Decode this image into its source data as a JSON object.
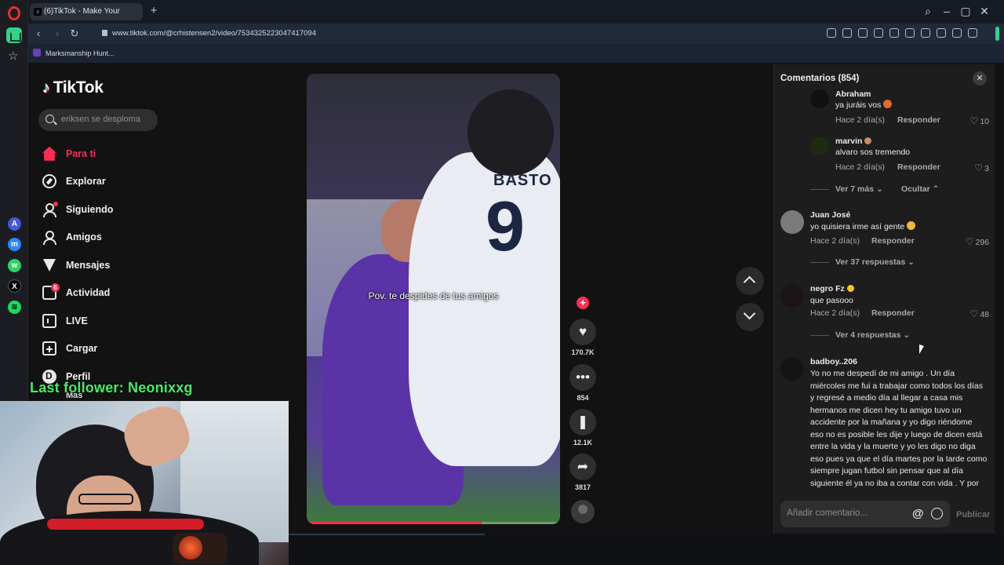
{
  "browser": {
    "tab_title": "(6)TikTok - Make Your",
    "url": "www.tiktok.com/@crhistensen2/video/7534325223047417094",
    "bookmark": "Marksmanship Hunt..."
  },
  "sidebar": {
    "logo": "TikTok",
    "search_placeholder": "eriksen se desploma",
    "items": [
      {
        "label": "Para ti",
        "icon": "home-icon"
      },
      {
        "label": "Explorar",
        "icon": "compass-icon"
      },
      {
        "label": "Siguiendo",
        "icon": "following-icon"
      },
      {
        "label": "Amigos",
        "icon": "friends-icon"
      },
      {
        "label": "Mensajes",
        "icon": "messages-icon"
      },
      {
        "label": "Actividad",
        "icon": "activity-icon",
        "badge": "6"
      },
      {
        "label": "LIVE",
        "icon": "live-icon"
      },
      {
        "label": "Cargar",
        "icon": "upload-icon"
      },
      {
        "label": "Perfil",
        "icon": "profile-icon"
      }
    ],
    "more": "Más"
  },
  "overlay": {
    "last_follower": "Last follower: Neonixxg"
  },
  "video": {
    "caption": "Pov. te despides de tus amigos",
    "jersey_name": "BASTO",
    "jersey_number": "9",
    "progress": 0.69
  },
  "actions": {
    "likes": "170.7K",
    "comments": "854",
    "saves": "12.1K",
    "shares": "3817"
  },
  "comments": {
    "header": "Comentarios (854)",
    "reply_label": "Responder",
    "items": [
      {
        "name": "Abraham",
        "text": "ya juráis vos",
        "time": "Hace 2 día(s)",
        "likes": "10"
      },
      {
        "name": "marvin",
        "text": "alvaro sos tremendo",
        "time": "Hace 2 día(s)",
        "likes": "3"
      },
      {
        "name": "Juan José",
        "text": "yo quisiera irme así gente",
        "time": "Hace 2 día(s)",
        "likes": "296"
      },
      {
        "name": "negro Fz",
        "text": "que pasooo",
        "time": "Hace 2 día(s)",
        "likes": "48"
      },
      {
        "name": "badboy..206",
        "text": "Yo no me despedí de mi amigo . Un día miércoles me fui a trabajar como todos los días y regresé a medio día al llegar a casa mis hermanos me dicen hey tu amigo tuvo un accidente por la mañana y yo digo riéndome eso no es posible les dije y luego de dicen está entre la vida y la muerte y yo les digo no diga eso  pues ya que el día martes por la tarde como siempre jugan futbol sin pensar que al día siguiente él ya no iba a contar con vida . Y por"
      }
    ],
    "view_more_1": "Ver 7 más",
    "hide": "Ocultar",
    "view_more_2": "Ver 37 respuestas",
    "view_more_3": "Ver 4 respuestas",
    "input_placeholder": "Añadir comentario...",
    "publish": "Publicar"
  }
}
